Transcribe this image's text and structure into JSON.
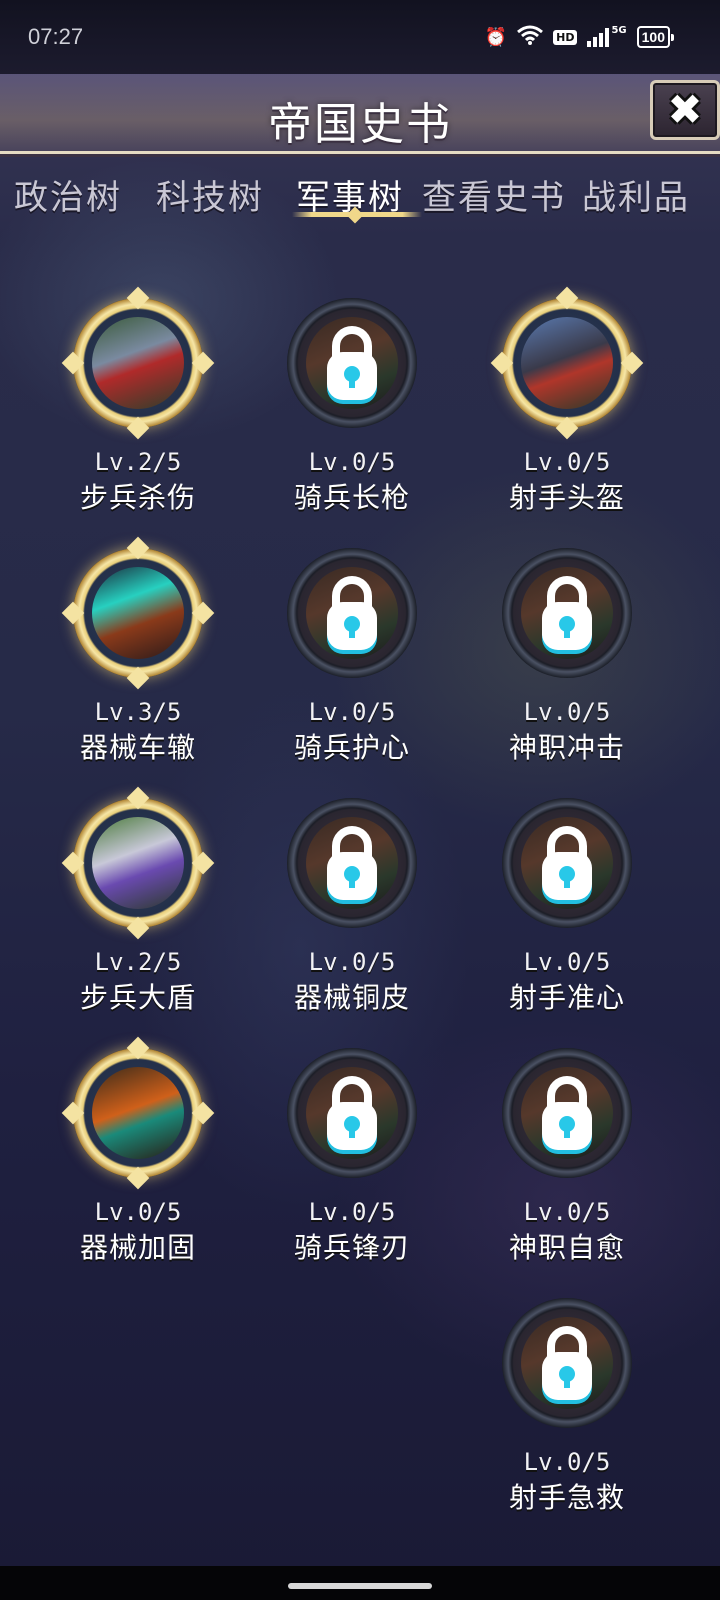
{
  "status": {
    "time": "07:27",
    "icons": [
      "alarm-icon",
      "wifi-icon",
      "hd-icon",
      "signal-icon",
      "5g-icon",
      "battery-icon"
    ],
    "hd": "HD",
    "network": "5G",
    "battery": "100"
  },
  "header": {
    "title": "帝国史书",
    "close_icon": "close-icon"
  },
  "tabs": [
    {
      "label": "政治树",
      "active": false
    },
    {
      "label": "科技树",
      "active": false
    },
    {
      "label": "军事树",
      "active": true
    },
    {
      "label": "查看史书",
      "active": false
    },
    {
      "label": "战利品",
      "active": false
    }
  ],
  "colors": {
    "accent_gold": "#f0d88a",
    "lock_cyan": "#28c8e8",
    "background": "#1b1a33"
  },
  "skills": [
    {
      "level": "Lv.2/5",
      "name": "步兵杀伤",
      "locked": false
    },
    {
      "level": "Lv.0/5",
      "name": "骑兵长枪",
      "locked": true
    },
    {
      "level": "Lv.0/5",
      "name": "射手头盔",
      "locked": false
    },
    {
      "level": "Lv.3/5",
      "name": "器械车辙",
      "locked": false
    },
    {
      "level": "Lv.0/5",
      "name": "骑兵护心",
      "locked": true
    },
    {
      "level": "Lv.0/5",
      "name": "神职冲击",
      "locked": true
    },
    {
      "level": "Lv.2/5",
      "name": "步兵大盾",
      "locked": false
    },
    {
      "level": "Lv.0/5",
      "name": "器械铜皮",
      "locked": true
    },
    {
      "level": "Lv.0/5",
      "name": "射手准心",
      "locked": true
    },
    {
      "level": "Lv.0/5",
      "name": "器械加固",
      "locked": false
    },
    {
      "level": "Lv.0/5",
      "name": "骑兵锋刃",
      "locked": true
    },
    {
      "level": "Lv.0/5",
      "name": "神职自愈",
      "locked": true
    },
    {
      "level": "Lv.0/5",
      "name": "射手急救",
      "locked": true
    }
  ]
}
